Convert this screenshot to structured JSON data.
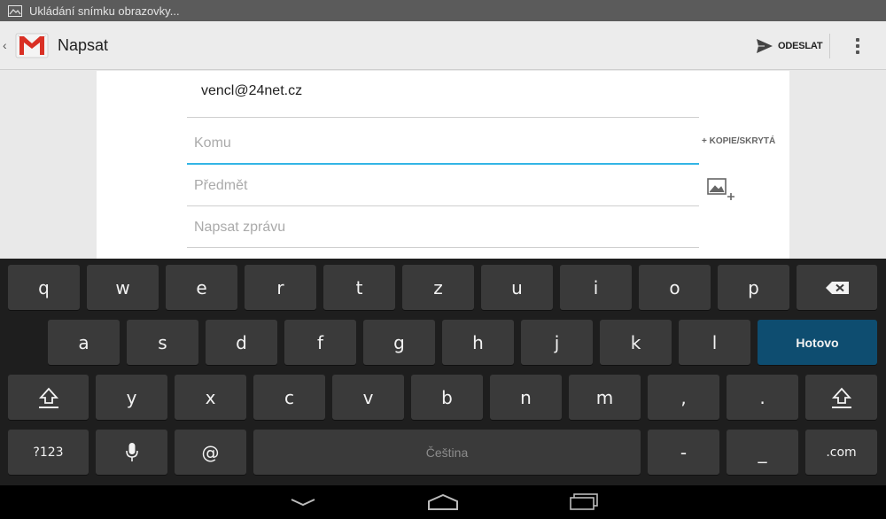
{
  "status_bar": {
    "notification_text": "Ukládání snímku obrazovky...",
    "icon": "screenshot-icon"
  },
  "action_bar": {
    "title": "Napsat",
    "app_icon": "gmail-icon",
    "send_label": "ODESLAT",
    "send_icon": "send-icon",
    "overflow_icon": "overflow-menu-icon"
  },
  "compose": {
    "from": "vencl@24net.cz",
    "to_placeholder": "Komu",
    "to_value": "",
    "cc_bcc_label": "+ KOPIE/SKRYTÁ",
    "subject_placeholder": "Předmět",
    "subject_value": "",
    "body_placeholder": "Napsat zprávu",
    "body_value": "",
    "attach_icon": "attach-picture-icon",
    "accent_color": "#33b5e5"
  },
  "keyboard": {
    "row1": [
      "q",
      "w",
      "e",
      "r",
      "t",
      "z",
      "u",
      "i",
      "o",
      "p"
    ],
    "row2": [
      "a",
      "s",
      "d",
      "f",
      "g",
      "h",
      "j",
      "k",
      "l"
    ],
    "done_label": "Hotovo",
    "row3": [
      "y",
      "x",
      "c",
      "v",
      "b",
      "n",
      "m",
      ",",
      "."
    ],
    "symbols_label": "?123",
    "at_label": "@",
    "space_label": "Čeština",
    "dash_label": "-",
    "underscore_label": "_",
    "dotcom_label": ".com",
    "done_color": "#0e4d70",
    "icons": [
      "backspace-icon",
      "shift-icon",
      "microphone-icon"
    ]
  },
  "navigation": {
    "icons": [
      "back-icon",
      "home-icon",
      "recent-apps-icon"
    ]
  }
}
